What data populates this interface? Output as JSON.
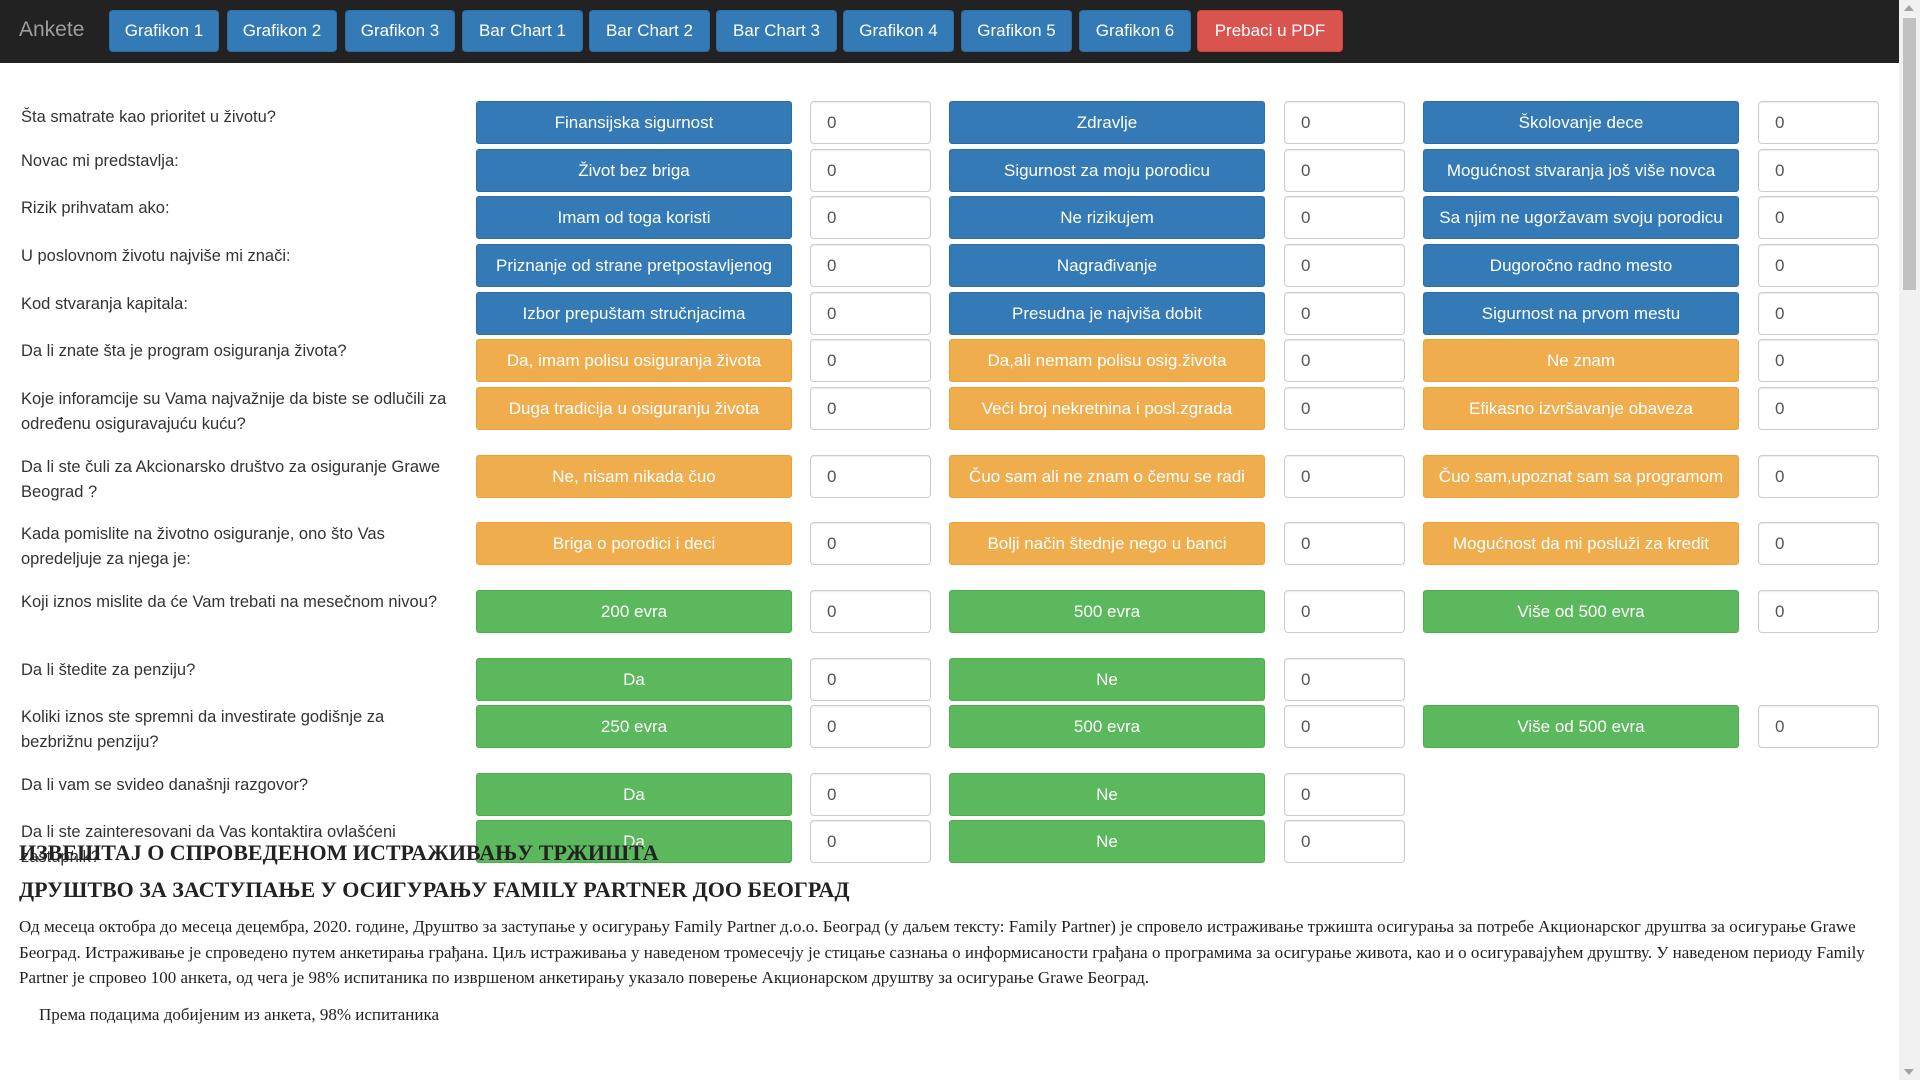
{
  "brand": "Ankete",
  "nav": [
    "Grafikon 1",
    "Grafikon 2",
    "Grafikon 3",
    "Bar Chart 1",
    "Bar Chart 2",
    "Bar Chart 3",
    "Grafikon 4",
    "Grafikon 5",
    "Grafikon 6"
  ],
  "pdf_button": "Prebaci u PDF",
  "colors": {
    "primary": "#337ab7",
    "warning": "#f0ad4e",
    "success": "#5cb85c",
    "danger": "#d9534f",
    "navbar": "#222222"
  },
  "questions": [
    {
      "label": "Šta smatrate kao prioritet u životu?",
      "style": "primary",
      "answers": [
        {
          "text": "Finansijska sigurnost",
          "count": "0"
        },
        {
          "text": "Zdravlje",
          "count": "0"
        },
        {
          "text": "Školovanje dece",
          "count": "0"
        }
      ]
    },
    {
      "label": "Novac mi predstavlja:",
      "style": "primary",
      "answers": [
        {
          "text": "Život bez briga",
          "count": "0"
        },
        {
          "text": "Sigurnost za moju porodicu",
          "count": "0"
        },
        {
          "text": "Mogućnost stvaranja još više novca",
          "count": "0"
        }
      ]
    },
    {
      "label": "Rizik prihvatam ako:",
      "style": "primary",
      "answers": [
        {
          "text": "Imam od toga koristi",
          "count": "0"
        },
        {
          "text": "Ne rizikujem",
          "count": "0"
        },
        {
          "text": "Sa njim ne ugoržavam svoju porodicu",
          "count": "0"
        }
      ]
    },
    {
      "label": "U poslovnom životu najviše mi znači:",
      "style": "primary",
      "answers": [
        {
          "text": "Priznanje od strane pretpostavljenog",
          "count": "0"
        },
        {
          "text": "Nagrađivanje",
          "count": "0"
        },
        {
          "text": "Dugoročno radno mesto",
          "count": "0"
        }
      ]
    },
    {
      "label": "Kod stvaranja kapitala:",
      "style": "primary",
      "answers": [
        {
          "text": "Izbor prepuštam stručnjacima",
          "count": "0"
        },
        {
          "text": "Presudna je najviša dobit",
          "count": "0"
        },
        {
          "text": "Sigurnost na prvom mestu",
          "count": "0"
        }
      ]
    },
    {
      "label": "Da li znate šta je program osiguranja života?",
      "style": "warning",
      "answers": [
        {
          "text": "Da, imam polisu osiguranja života",
          "count": "0"
        },
        {
          "text": "Da,ali nemam polisu osig.života",
          "count": "0"
        },
        {
          "text": "Ne znam",
          "count": "0"
        }
      ]
    },
    {
      "label": "Koje inforamcije su Vama najvažnije da biste se odlučili za određenu osiguravajuću kuću?",
      "style": "warning",
      "answers": [
        {
          "text": "Duga tradicija u osiguranju života",
          "count": "0"
        },
        {
          "text": "Veći broj nekretnina i posl.zgrada",
          "count": "0"
        },
        {
          "text": "Efikasno izvršavanje obaveza",
          "count": "0"
        }
      ]
    },
    {
      "label": "Da li ste čuli za Akcionarsko društvo za osiguranje Grawe Beograd ?",
      "style": "warning",
      "answers": [
        {
          "text": "Ne, nisam nikada čuo",
          "count": "0"
        },
        {
          "text": "Čuo sam ali ne znam o čemu se radi",
          "count": "0"
        },
        {
          "text": "Čuo sam,upoznat sam sa programom",
          "count": "0"
        }
      ]
    },
    {
      "label": "Kada pomislite na životno osiguranje, ono što Vas opredeljuje za njega je:",
      "style": "warning",
      "answers": [
        {
          "text": "Briga o porodici i deci",
          "count": "0"
        },
        {
          "text": "Bolji način štednje nego u banci",
          "count": "0"
        },
        {
          "text": "Mogućnost da mi posluži za kredit",
          "count": "0"
        }
      ]
    },
    {
      "label": "Koji iznos mislite da će Vam trebati na mesečnom nivou?",
      "style": "success",
      "answers": [
        {
          "text": "200 evra",
          "count": "0"
        },
        {
          "text": "500 evra",
          "count": "0"
        },
        {
          "text": "Više od 500 evra",
          "count": "0"
        }
      ]
    },
    {
      "label": "Da li štedite za penziju?",
      "style": "success",
      "answers": [
        {
          "text": "Da",
          "count": "0"
        },
        {
          "text": "Ne",
          "count": "0"
        }
      ]
    },
    {
      "label": "Koliki iznos ste spremni da investirate godišnje za bezbrižnu penziju?",
      "style": "success",
      "answers": [
        {
          "text": "250 evra",
          "count": "0"
        },
        {
          "text": "500 evra",
          "count": "0"
        },
        {
          "text": "Više od 500 evra",
          "count": "0"
        }
      ]
    },
    {
      "label": "Da li vam se svideo današnji razgovor?",
      "style": "success",
      "answers": [
        {
          "text": "Da",
          "count": "0"
        },
        {
          "text": "Ne",
          "count": "0"
        }
      ]
    },
    {
      "label": "Da li ste zainteresovani da Vas kontaktira ovlašćeni zastupnik?",
      "style": "success",
      "answers": [
        {
          "text": "Da",
          "count": "0"
        },
        {
          "text": "Ne",
          "count": "0"
        }
      ]
    }
  ],
  "report": {
    "title1": "ИЗВЕШТАЈ О СПРОВЕДЕНОМ ИСТРАЖИВАЊУ ТРЖИШТА",
    "title2": "ДРУШТВО ЗА ЗАСТУПАЊЕ У ОСИГУРАЊУ FAMILY PARTNER ДОО БЕОГРАД",
    "paragraph": "Од месеца октобра до месеца децембра, 2020. године, Друштво за заступање у осигурању Family Partner д.о.о. Београд (у даљем тексту: Family Partner) је спровело истраживање тржишта осигурања за потребе Акционарског друштва за осигурање Grawe Београд. Истраживање је спроведено путем анкетирања грађана. Циљ истраживања у наведеном тромесечју је стицање сазнања о информисаности грађана о програмима за осигурање живота, као и о осигуравајућем друштву. У наведеном периоду Family Partner је спровео 100 анкета, од чега је 98% испитаника по извршеном анкетирању указало поверење Акционарском друштву за осигурање Grawe Београд.",
    "paragraph2": "Према подацима добијеним из анкета, 98% испитаника"
  }
}
